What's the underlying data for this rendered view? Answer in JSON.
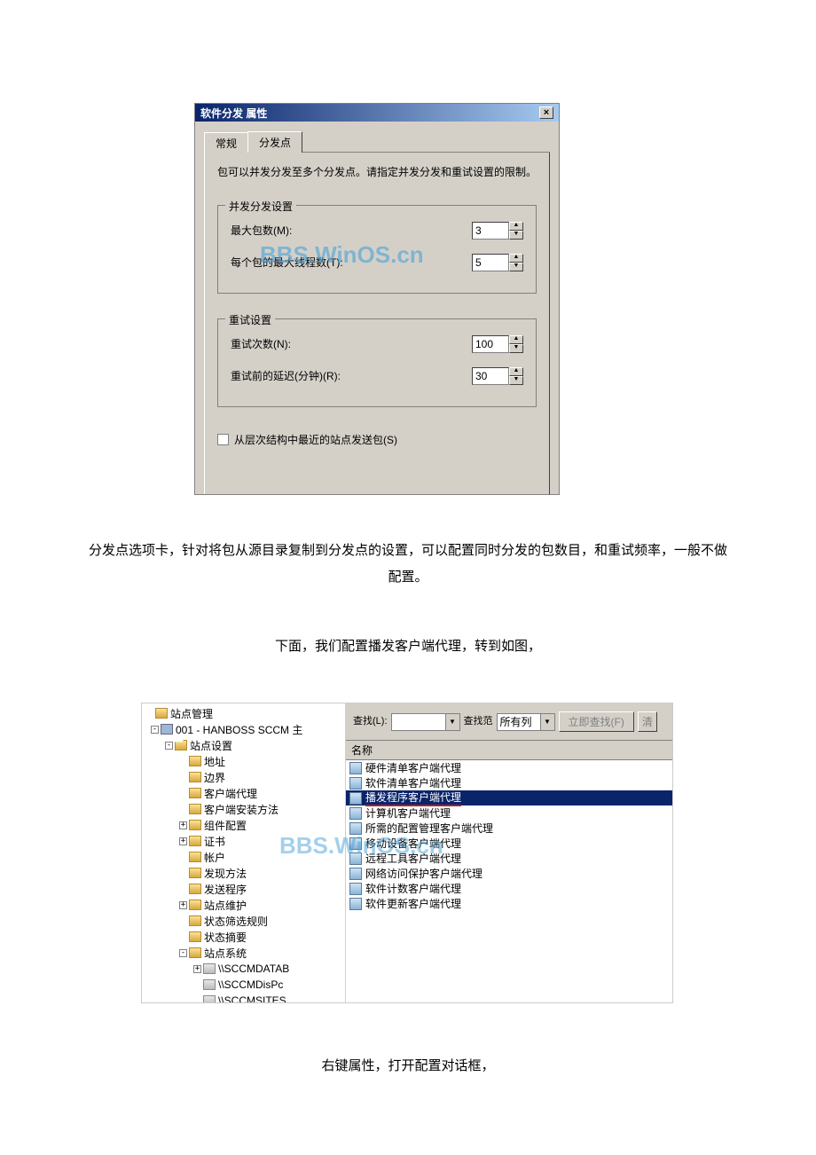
{
  "dialog1": {
    "title": "软件分发 属性",
    "close": "×",
    "tabs": {
      "general": "常规",
      "dist": "分发点"
    },
    "desc": "包可以并发分发至多个分发点。请指定并发分发和重试设置的限制。",
    "group1": {
      "legend": "并发分发设置",
      "maxPackagesLabel": "最大包数(M):",
      "maxPackagesValue": "3",
      "maxThreadsLabel": "每个包的最大线程数(T):",
      "maxThreadsValue": "5"
    },
    "group2": {
      "legend": "重试设置",
      "retryCountLabel": "重试次数(N):",
      "retryCountValue": "100",
      "retryDelayLabel": "重试前的延迟(分钟)(R):",
      "retryDelayValue": "30"
    },
    "checkboxLabel": "从层次结构中最近的站点发送包(S)",
    "watermark": "BBS.WinOS.cn"
  },
  "para1": "分发点选项卡，针对将包从源目录复制到分发点的设置，可以配置同时分发的包数目，和重试频率，一般不做配置。",
  "para2": "下面，我们配置播发客户端代理，转到如图，",
  "scr2": {
    "treeRoot": "站点管理",
    "treeSite": "001 - HANBOSS SCCM 主",
    "treeSettings": "站点设置",
    "treeItems": [
      "地址",
      "边界",
      "客户端代理",
      "客户端安装方法",
      "组件配置",
      "证书",
      "帐户",
      "发现方法",
      "发送程序",
      "站点维护",
      "状态筛选规则",
      "状态摘要",
      "站点系统"
    ],
    "treeServers": [
      "\\\\SCCMDATAB",
      "\\\\SCCMDisPc",
      "\\\\SCCMSITES"
    ],
    "toolbar": {
      "findLabel": "查找(L):",
      "rangeLabel": "查找范",
      "allCols": "所有列",
      "findNow": "立即查找(F)",
      "clear": "清"
    },
    "colHeader": "名称",
    "listItems": [
      "硬件清单客户端代理",
      "软件清单客户端代理",
      "播发程序客户端代理",
      "计算机客户端代理",
      "所需的配置管理客户端代理",
      "移动设备客户端代理",
      "远程工具客户端代理",
      "网络访问保护客户端代理",
      "软件计数客户端代理",
      "软件更新客户端代理"
    ],
    "selectedIndex": 2,
    "watermark": "BBS.WinOS.cn"
  },
  "para3": "右键属性，打开配置对话框，"
}
